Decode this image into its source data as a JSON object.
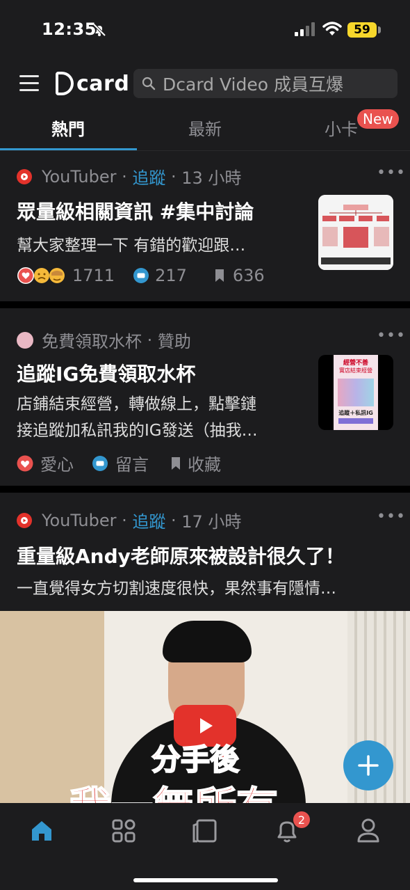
{
  "status_bar": {
    "time": "12:35",
    "battery": "59"
  },
  "header": {
    "logo_text": "card",
    "search_placeholder": "Dcard Video 成員互爆"
  },
  "tabs": [
    {
      "label": "熱門",
      "active": true
    },
    {
      "label": "最新",
      "active": false
    },
    {
      "label": "小卡",
      "active": false,
      "badge": "New"
    }
  ],
  "posts": [
    {
      "forum": "YouTuber",
      "follow": "追蹤",
      "time": "13 小時",
      "title": "眾量級相關資訊 #集中討論",
      "excerpt": "幫大家整理一下 有錯的歡迎跟…",
      "likes": "1711",
      "comments": "217",
      "saves": "636",
      "more": "•••"
    },
    {
      "forum": "免費領取水杯",
      "sponsored": "贊助",
      "title": "追蹤IG免費領取水杯",
      "excerpt_lines": [
        "店鋪結束經營，轉做線上，點擊鏈",
        "接追蹤加私訊我的IG發送（抽我…"
      ],
      "like_label": "愛心",
      "comment_label": "留言",
      "save_label": "收藏",
      "more": "•••",
      "thumb_text": [
        "經營不善",
        "實店結束經營",
        "追蹤＋私訊IG"
      ]
    },
    {
      "forum": "YouTuber",
      "follow": "追蹤",
      "time": "17 小時",
      "title": "重量級Andy老師原來被設計很久了！",
      "excerpt": "一直覺得女方切割速度很快，果然事有隱情…",
      "more": "•••",
      "video_caption": [
        "分手後",
        "我一無所有"
      ]
    }
  ],
  "bottom_nav": {
    "notification_count": "2"
  },
  "colors": {
    "accent": "#3397cf",
    "background": "#1c1c1e",
    "badge": "#e9524f"
  }
}
